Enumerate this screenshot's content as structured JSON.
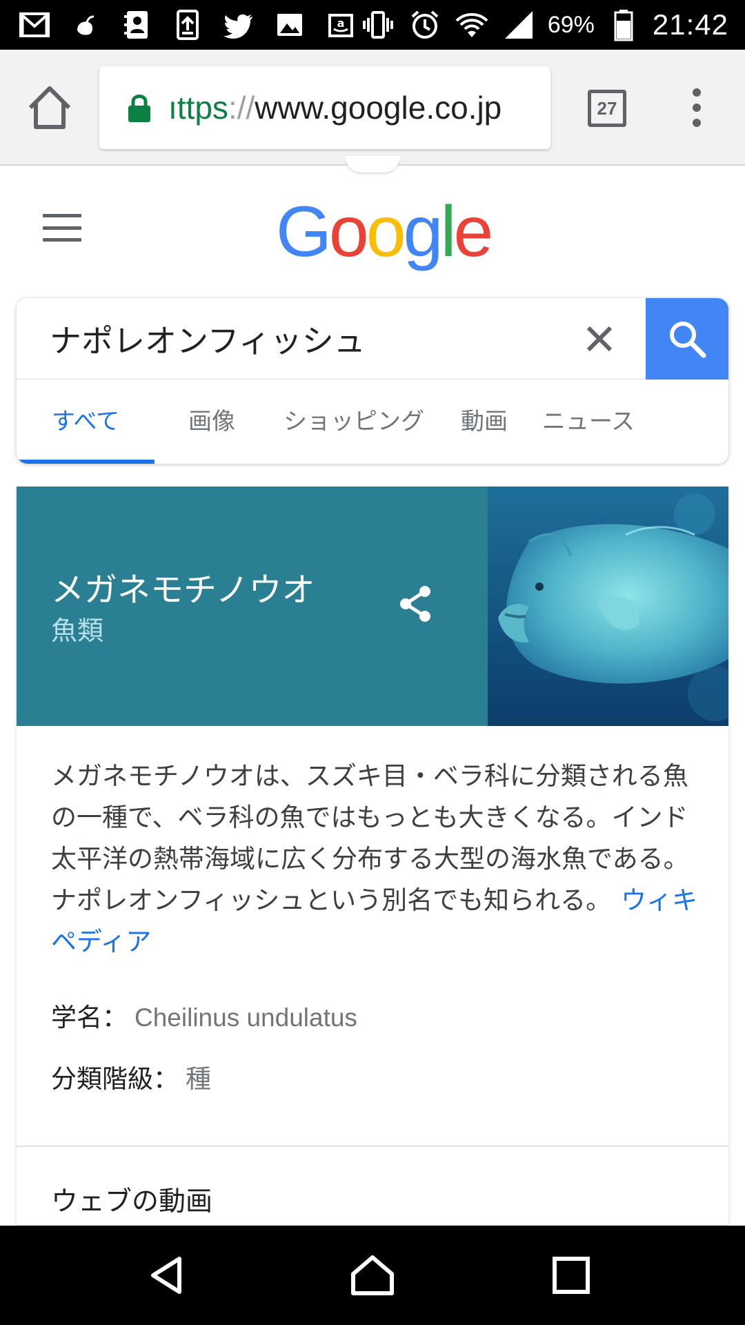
{
  "status_bar": {
    "left_icons": [
      "gmail-icon",
      "notification-app-icon",
      "contacts-app-icon",
      "upload-app-icon",
      "twitter-icon",
      "gallery-icon",
      "amazon-icon"
    ],
    "right_icons": [
      "vibrate-icon",
      "alarm-icon",
      "wifi-icon",
      "signal-icon",
      "battery-icon"
    ],
    "battery": "69%",
    "time": "21:42"
  },
  "browser": {
    "url_scheme": "ıttps",
    "url_separator": "://",
    "url_host": "www.google.co.jp",
    "tab_count": "27",
    "colors": {
      "toolbar": "#f2f2f2",
      "secure": "#0b8043"
    }
  },
  "google": {
    "logo_letters": [
      {
        "char": "G",
        "color": "#4285f4"
      },
      {
        "char": "o",
        "color": "#ea4335"
      },
      {
        "char": "o",
        "color": "#fbbc05"
      },
      {
        "char": "g",
        "color": "#4285f4"
      },
      {
        "char": "l",
        "color": "#34a853"
      },
      {
        "char": "e",
        "color": "#ea4335"
      }
    ]
  },
  "search": {
    "query": "ナポレオンフィッシュ",
    "tabs": [
      {
        "label": "すべて",
        "active": true
      },
      {
        "label": "画像",
        "active": false
      },
      {
        "label": "ショッピング",
        "active": false
      },
      {
        "label": "動画",
        "active": false
      },
      {
        "label": "ニュース",
        "active": false
      }
    ],
    "accent_color": "#1a73e8",
    "button_color": "#4285f4"
  },
  "knowledge_panel": {
    "title": "メガネモチノウオ",
    "subtitle": "魚類",
    "header_color": "#2a7f93",
    "description": "メガネモチノウオは、スズキ目・ベラ科に分類される魚の一種で、ベラ科の魚ではもっとも大きくなる。インド太平洋の熱帯海域に広く分布する大型の海水魚である。ナポレオンフィッシュという別名でも知られる。",
    "wiki_link": "ウィキペディア",
    "facts": [
      {
        "key": "学名：",
        "value": "Cheilinus undulatus"
      },
      {
        "key": "分類階級：",
        "value": "種"
      }
    ],
    "section_title": "ウェブの動画"
  },
  "nav_bar": {
    "buttons": [
      "back-icon",
      "home-icon",
      "recents-icon"
    ]
  }
}
